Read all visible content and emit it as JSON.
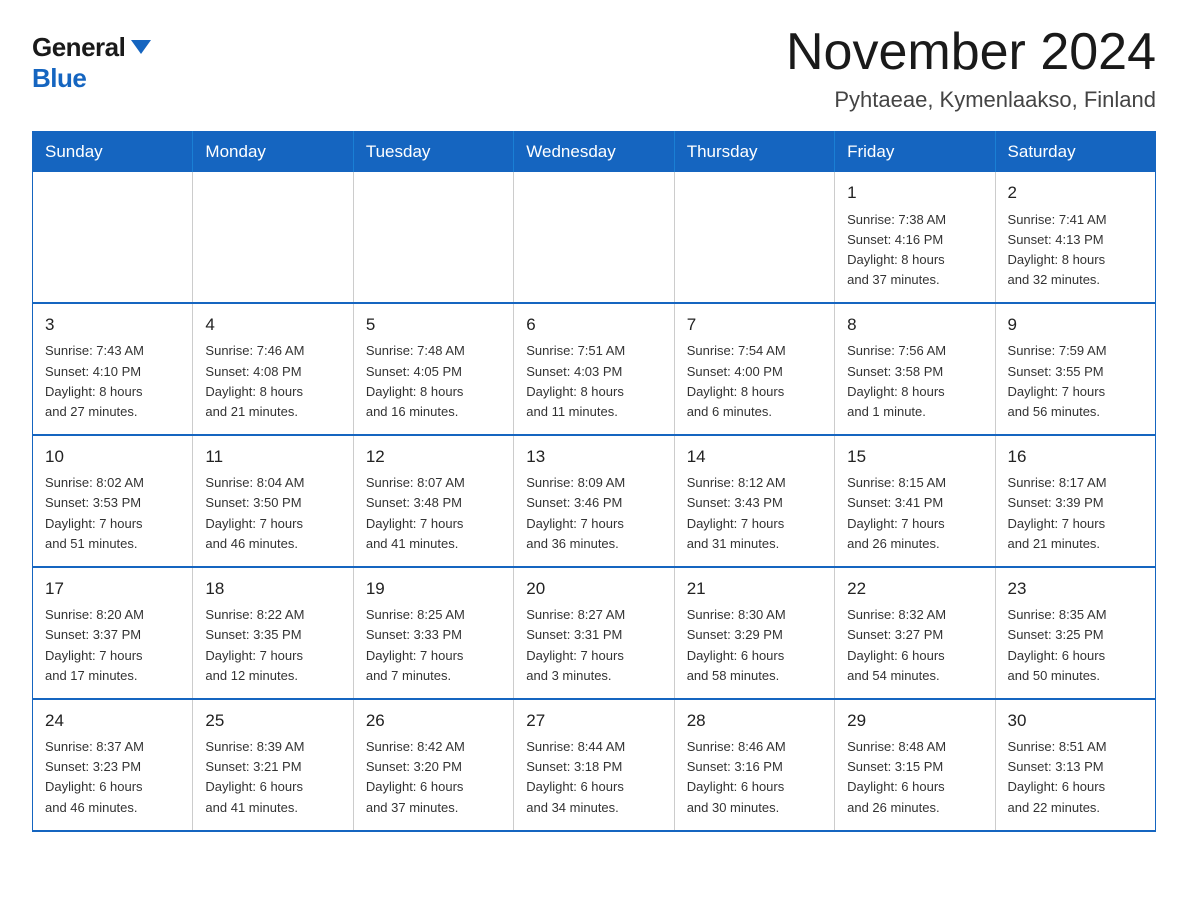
{
  "logo": {
    "general": "General",
    "blue": "Blue"
  },
  "header": {
    "month": "November 2024",
    "location": "Pyhtaeae, Kymenlaakso, Finland"
  },
  "weekdays": [
    "Sunday",
    "Monday",
    "Tuesday",
    "Wednesday",
    "Thursday",
    "Friday",
    "Saturday"
  ],
  "weeks": [
    {
      "days": [
        {
          "num": "",
          "info": ""
        },
        {
          "num": "",
          "info": ""
        },
        {
          "num": "",
          "info": ""
        },
        {
          "num": "",
          "info": ""
        },
        {
          "num": "",
          "info": ""
        },
        {
          "num": "1",
          "info": "Sunrise: 7:38 AM\nSunset: 4:16 PM\nDaylight: 8 hours\nand 37 minutes."
        },
        {
          "num": "2",
          "info": "Sunrise: 7:41 AM\nSunset: 4:13 PM\nDaylight: 8 hours\nand 32 minutes."
        }
      ]
    },
    {
      "days": [
        {
          "num": "3",
          "info": "Sunrise: 7:43 AM\nSunset: 4:10 PM\nDaylight: 8 hours\nand 27 minutes."
        },
        {
          "num": "4",
          "info": "Sunrise: 7:46 AM\nSunset: 4:08 PM\nDaylight: 8 hours\nand 21 minutes."
        },
        {
          "num": "5",
          "info": "Sunrise: 7:48 AM\nSunset: 4:05 PM\nDaylight: 8 hours\nand 16 minutes."
        },
        {
          "num": "6",
          "info": "Sunrise: 7:51 AM\nSunset: 4:03 PM\nDaylight: 8 hours\nand 11 minutes."
        },
        {
          "num": "7",
          "info": "Sunrise: 7:54 AM\nSunset: 4:00 PM\nDaylight: 8 hours\nand 6 minutes."
        },
        {
          "num": "8",
          "info": "Sunrise: 7:56 AM\nSunset: 3:58 PM\nDaylight: 8 hours\nand 1 minute."
        },
        {
          "num": "9",
          "info": "Sunrise: 7:59 AM\nSunset: 3:55 PM\nDaylight: 7 hours\nand 56 minutes."
        }
      ]
    },
    {
      "days": [
        {
          "num": "10",
          "info": "Sunrise: 8:02 AM\nSunset: 3:53 PM\nDaylight: 7 hours\nand 51 minutes."
        },
        {
          "num": "11",
          "info": "Sunrise: 8:04 AM\nSunset: 3:50 PM\nDaylight: 7 hours\nand 46 minutes."
        },
        {
          "num": "12",
          "info": "Sunrise: 8:07 AM\nSunset: 3:48 PM\nDaylight: 7 hours\nand 41 minutes."
        },
        {
          "num": "13",
          "info": "Sunrise: 8:09 AM\nSunset: 3:46 PM\nDaylight: 7 hours\nand 36 minutes."
        },
        {
          "num": "14",
          "info": "Sunrise: 8:12 AM\nSunset: 3:43 PM\nDaylight: 7 hours\nand 31 minutes."
        },
        {
          "num": "15",
          "info": "Sunrise: 8:15 AM\nSunset: 3:41 PM\nDaylight: 7 hours\nand 26 minutes."
        },
        {
          "num": "16",
          "info": "Sunrise: 8:17 AM\nSunset: 3:39 PM\nDaylight: 7 hours\nand 21 minutes."
        }
      ]
    },
    {
      "days": [
        {
          "num": "17",
          "info": "Sunrise: 8:20 AM\nSunset: 3:37 PM\nDaylight: 7 hours\nand 17 minutes."
        },
        {
          "num": "18",
          "info": "Sunrise: 8:22 AM\nSunset: 3:35 PM\nDaylight: 7 hours\nand 12 minutes."
        },
        {
          "num": "19",
          "info": "Sunrise: 8:25 AM\nSunset: 3:33 PM\nDaylight: 7 hours\nand 7 minutes."
        },
        {
          "num": "20",
          "info": "Sunrise: 8:27 AM\nSunset: 3:31 PM\nDaylight: 7 hours\nand 3 minutes."
        },
        {
          "num": "21",
          "info": "Sunrise: 8:30 AM\nSunset: 3:29 PM\nDaylight: 6 hours\nand 58 minutes."
        },
        {
          "num": "22",
          "info": "Sunrise: 8:32 AM\nSunset: 3:27 PM\nDaylight: 6 hours\nand 54 minutes."
        },
        {
          "num": "23",
          "info": "Sunrise: 8:35 AM\nSunset: 3:25 PM\nDaylight: 6 hours\nand 50 minutes."
        }
      ]
    },
    {
      "days": [
        {
          "num": "24",
          "info": "Sunrise: 8:37 AM\nSunset: 3:23 PM\nDaylight: 6 hours\nand 46 minutes."
        },
        {
          "num": "25",
          "info": "Sunrise: 8:39 AM\nSunset: 3:21 PM\nDaylight: 6 hours\nand 41 minutes."
        },
        {
          "num": "26",
          "info": "Sunrise: 8:42 AM\nSunset: 3:20 PM\nDaylight: 6 hours\nand 37 minutes."
        },
        {
          "num": "27",
          "info": "Sunrise: 8:44 AM\nSunset: 3:18 PM\nDaylight: 6 hours\nand 34 minutes."
        },
        {
          "num": "28",
          "info": "Sunrise: 8:46 AM\nSunset: 3:16 PM\nDaylight: 6 hours\nand 30 minutes."
        },
        {
          "num": "29",
          "info": "Sunrise: 8:48 AM\nSunset: 3:15 PM\nDaylight: 6 hours\nand 26 minutes."
        },
        {
          "num": "30",
          "info": "Sunrise: 8:51 AM\nSunset: 3:13 PM\nDaylight: 6 hours\nand 22 minutes."
        }
      ]
    }
  ]
}
